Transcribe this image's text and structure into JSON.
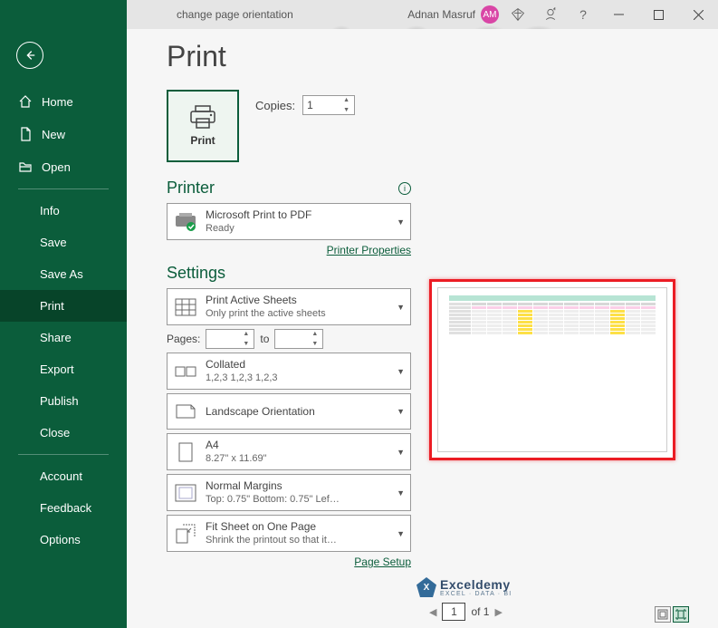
{
  "titlebar": {
    "doc_name": "change page orientation",
    "user_name": "Adnan Masruf",
    "avatar_initials": "AM"
  },
  "sidebar": {
    "items": [
      {
        "label": "Home"
      },
      {
        "label": "New"
      },
      {
        "label": "Open"
      },
      {
        "label": "Info"
      },
      {
        "label": "Save"
      },
      {
        "label": "Save As"
      },
      {
        "label": "Print"
      },
      {
        "label": "Share"
      },
      {
        "label": "Export"
      },
      {
        "label": "Publish"
      },
      {
        "label": "Close"
      },
      {
        "label": "Account"
      },
      {
        "label": "Feedback"
      },
      {
        "label": "Options"
      }
    ]
  },
  "print": {
    "heading": "Print",
    "button_label": "Print",
    "copies_label": "Copies:",
    "copies_value": "1",
    "printer_heading": "Printer",
    "printer_name": "Microsoft Print to PDF",
    "printer_status": "Ready",
    "printer_properties": "Printer Properties",
    "settings_heading": "Settings",
    "pages_label": "Pages:",
    "pages_to": "to",
    "setting_sheets_title": "Print Active Sheets",
    "setting_sheets_sub": "Only print the active sheets",
    "setting_collate_title": "Collated",
    "setting_collate_sub": "1,2,3    1,2,3    1,2,3",
    "setting_orientation": "Landscape Orientation",
    "setting_paper_title": "A4",
    "setting_paper_sub": "8.27\" x 11.69\"",
    "setting_margins_title": "Normal Margins",
    "setting_margins_sub": "Top: 0.75\" Bottom: 0.75\" Lef…",
    "setting_scaling_title": "Fit Sheet on One Page",
    "setting_scaling_sub": "Shrink the printout so that it…",
    "page_setup": "Page Setup"
  },
  "preview": {
    "current_page": "1",
    "page_of": "of 1"
  },
  "watermark": {
    "big": "Exceldemy",
    "small": "EXCEL · DATA · BI"
  }
}
